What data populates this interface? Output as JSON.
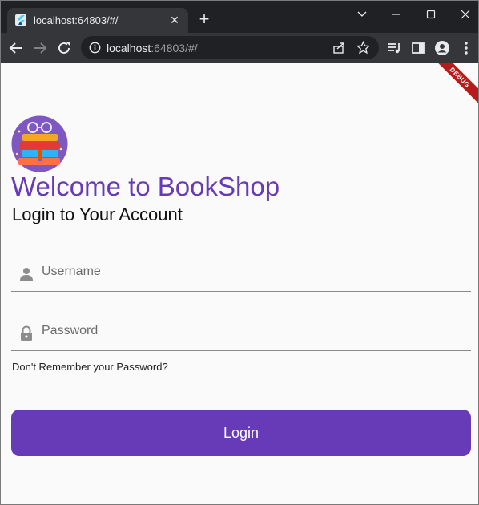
{
  "browser": {
    "tab_title": "localhost:64803/#/",
    "tab_close_glyph": "✕",
    "new_tab_glyph": "+",
    "url_host": "localhost",
    "url_rest": ":64803/#/",
    "icons": [
      "flutter-favicon",
      "back-arrow-icon",
      "forward-arrow-icon",
      "reload-icon",
      "info-icon",
      "share-icon",
      "star-icon",
      "media-icon",
      "side-panel-icon",
      "profile-icon",
      "more-icon"
    ]
  },
  "app": {
    "debug_banner": "DEBUG",
    "welcome_title": "Welcome to BookShop",
    "subtitle": "Login to Your Account",
    "username": {
      "placeholder": "Username",
      "value": ""
    },
    "password": {
      "placeholder": "Password",
      "value": ""
    },
    "forgot_password": "Don't Remember your Password?",
    "login_label": "Login",
    "accent_color": "#673ab7"
  }
}
